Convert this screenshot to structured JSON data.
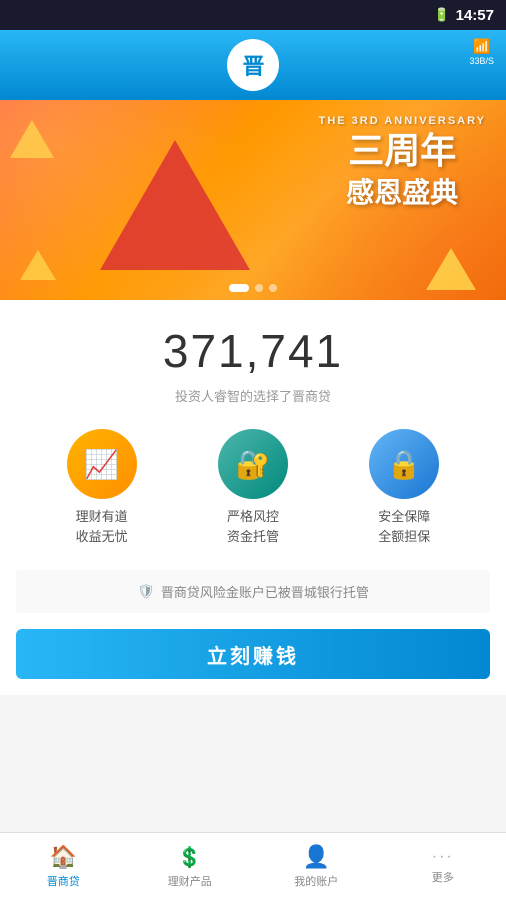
{
  "statusBar": {
    "time": "14:57",
    "batteryIcon": "🔋",
    "wifiSpeed": "33B/S"
  },
  "header": {
    "logoText": "晋",
    "wifiIcon": "📶"
  },
  "banner": {
    "subText": "THE 3RD ANNIVERSARY",
    "line1": "三周年",
    "line2": "感恩盛典",
    "dots": [
      true,
      false,
      false
    ]
  },
  "mainContent": {
    "bigNumber": "371,741",
    "subtitle": "投资人睿智的选择了晋商贷",
    "features": [
      {
        "iconType": "orange",
        "iconSymbol": "📈",
        "label": "理财有道\n收益无忧"
      },
      {
        "iconType": "teal",
        "iconSymbol": "🔐",
        "label": "严格风控\n资金托管"
      },
      {
        "iconType": "blue",
        "iconSymbol": "🔒",
        "label": "安全保障\n全额担保"
      }
    ],
    "trustNotice": "晋商贷风险金账户已被晋城银行托管",
    "ctaButton": "立刻赚钱"
  },
  "bottomNav": [
    {
      "id": "home",
      "icon": "🏠",
      "label": "晋商贷",
      "active": true
    },
    {
      "id": "products",
      "icon": "💲",
      "label": "理财产品",
      "active": false
    },
    {
      "id": "account",
      "icon": "👤",
      "label": "我的账户",
      "active": false
    },
    {
      "id": "more",
      "icon": "···",
      "label": "更多",
      "active": false
    }
  ]
}
